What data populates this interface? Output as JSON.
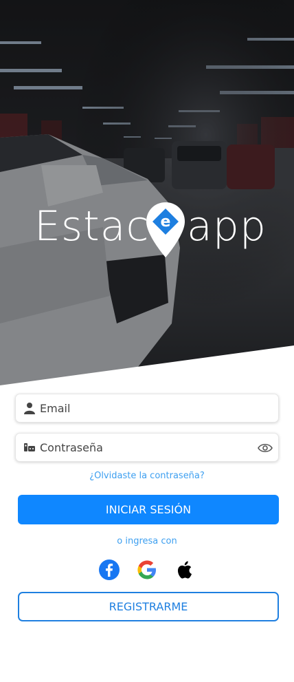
{
  "logo": {
    "left_text": "Estaci",
    "right_text": "app",
    "pin_letter": "e"
  },
  "email": {
    "placeholder": "Email",
    "icon": "user-icon"
  },
  "password": {
    "placeholder": "Contraseña",
    "icon": "password-icon",
    "toggle_icon": "eye-icon"
  },
  "forgot_link": "¿Olvidaste la contraseña?",
  "login_button": "INICIAR SESIÓN",
  "social_label": "o ingresa con",
  "social": [
    {
      "name": "facebook",
      "icon": "facebook-icon",
      "color": "#1877f2"
    },
    {
      "name": "google",
      "icon": "google-icon",
      "color": "#4285f4"
    },
    {
      "name": "apple",
      "icon": "apple-icon",
      "color": "#000000"
    }
  ],
  "register_button": "REGISTRARME",
  "colors": {
    "primary": "#0f87ff",
    "link": "#3d9ff0",
    "outline": "#1e7fe0"
  }
}
